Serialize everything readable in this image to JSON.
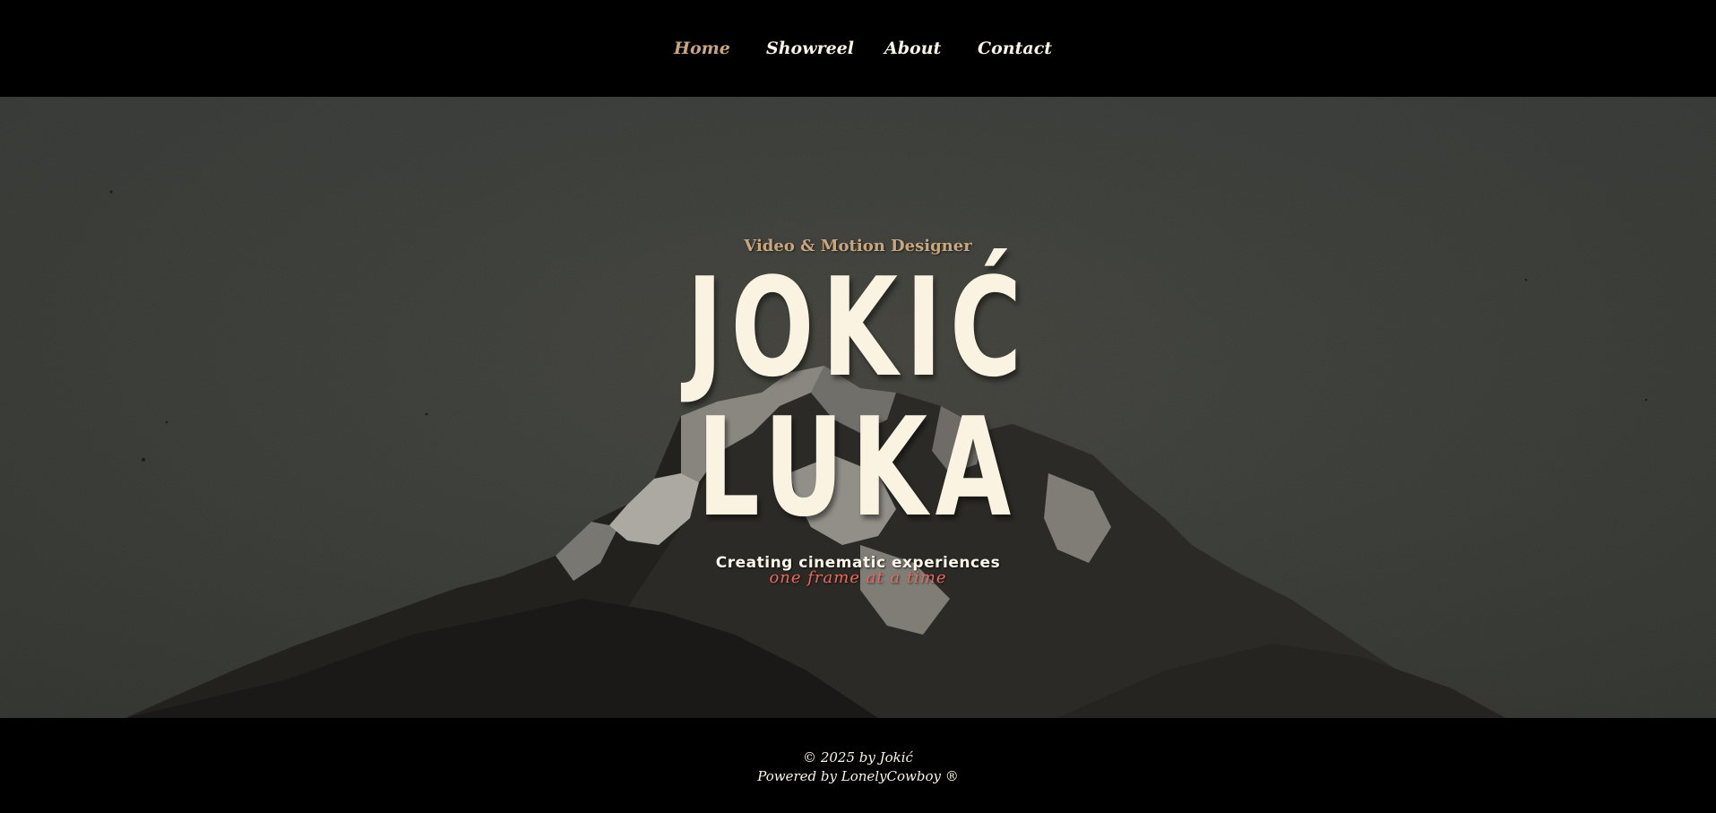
{
  "nav": {
    "items": [
      {
        "label": "Home",
        "active": true
      },
      {
        "label": "Showreel",
        "active": false
      },
      {
        "label": "About",
        "active": false
      },
      {
        "label": "Contact",
        "active": false
      }
    ]
  },
  "hero": {
    "subtitle": "Video & Motion Designer",
    "name_first": "JOKIĆ",
    "name_last": "LUKA",
    "tagline": "Creating cinematic experiences",
    "tagline_script": "one frame at a time"
  },
  "footer": {
    "copyright": "© 2025 by Jokić",
    "powered": "Powered by LonelyCowboy ®"
  },
  "colors": {
    "background": "#000000",
    "accent": "#c8a67e",
    "name": "#faf3e2",
    "script": "#e8695f"
  }
}
